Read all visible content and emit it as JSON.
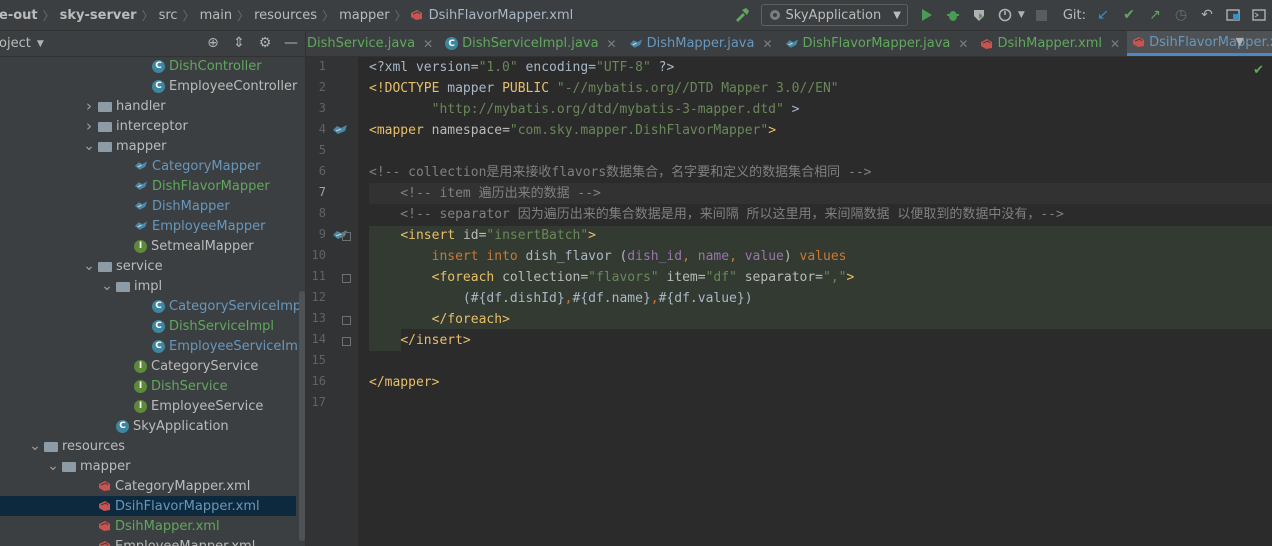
{
  "breadcrumb": {
    "items": [
      "e-out",
      "sky-server",
      "src",
      "main",
      "resources",
      "mapper"
    ],
    "file": "DsihFlavorMapper.xml"
  },
  "toolbar": {
    "run_config": "SkyApplication",
    "git_label": "Git:"
  },
  "project_pane": {
    "title": "roject",
    "tree": [
      {
        "indent": 152,
        "icon": "c",
        "label": "DishController",
        "color": "green"
      },
      {
        "indent": 152,
        "icon": "c",
        "label": "EmployeeController",
        "color": "default"
      },
      {
        "indent": 98,
        "arrow": "right",
        "icon": "folder",
        "label": "handler",
        "color": "default"
      },
      {
        "indent": 98,
        "arrow": "right",
        "icon": "folder",
        "label": "interceptor",
        "color": "default"
      },
      {
        "indent": 98,
        "arrow": "down",
        "icon": "folder",
        "label": "mapper",
        "color": "default"
      },
      {
        "indent": 134,
        "icon": "mapper",
        "label": "CategoryMapper",
        "color": "blue"
      },
      {
        "indent": 134,
        "icon": "mapper",
        "label": "DishFlavorMapper",
        "color": "green"
      },
      {
        "indent": 134,
        "icon": "mapper",
        "label": "DishMapper",
        "color": "blue"
      },
      {
        "indent": 134,
        "icon": "mapper",
        "label": "EmployeeMapper",
        "color": "blue"
      },
      {
        "indent": 134,
        "icon": "i",
        "label": "SetmealMapper",
        "color": "default"
      },
      {
        "indent": 98,
        "arrow": "down",
        "icon": "folder",
        "label": "service",
        "color": "default"
      },
      {
        "indent": 116,
        "arrow": "down",
        "icon": "folder",
        "label": "impl",
        "color": "default"
      },
      {
        "indent": 152,
        "icon": "c",
        "label": "CategoryServiceImpl",
        "color": "blue"
      },
      {
        "indent": 152,
        "icon": "c",
        "label": "DishServiceImpl",
        "color": "green"
      },
      {
        "indent": 152,
        "icon": "c",
        "label": "EmployeeServiceImp",
        "color": "blue"
      },
      {
        "indent": 134,
        "icon": "i",
        "label": "CategoryService",
        "color": "default"
      },
      {
        "indent": 134,
        "icon": "i",
        "label": "DishService",
        "color": "green"
      },
      {
        "indent": 134,
        "icon": "i",
        "label": "EmployeeService",
        "color": "default"
      },
      {
        "indent": 116,
        "icon": "c",
        "label": "SkyApplication",
        "color": "default"
      },
      {
        "indent": 44,
        "arrow": "down",
        "icon": "folder",
        "label": "resources",
        "color": "default"
      },
      {
        "indent": 62,
        "arrow": "down",
        "icon": "folder",
        "label": "mapper",
        "color": "default"
      },
      {
        "indent": 98,
        "icon": "xml",
        "label": "CategoryMapper.xml",
        "color": "default"
      },
      {
        "indent": 98,
        "icon": "xml",
        "label": "DsihFlavorMapper.xml",
        "color": "blue",
        "selected": true
      },
      {
        "indent": 98,
        "icon": "xml",
        "label": "DsihMapper.xml",
        "color": "green"
      },
      {
        "indent": 98,
        "icon": "xml",
        "label": "EmployeeMapper.xml",
        "color": "default"
      }
    ]
  },
  "tabs": [
    {
      "label": "DishService.java",
      "icon": "i",
      "color": "green"
    },
    {
      "label": "DishServiceImpl.java",
      "icon": "c",
      "color": "green"
    },
    {
      "label": "DishMapper.java",
      "icon": "mapper",
      "color": "blue"
    },
    {
      "label": "DishFlavorMapper.java",
      "icon": "mapper",
      "color": "green"
    },
    {
      "label": "DsihMapper.xml",
      "icon": "xml",
      "color": "green"
    },
    {
      "label": "DsihFlavorMapper.xml",
      "icon": "xml",
      "color": "blue",
      "active": true
    }
  ],
  "editor": {
    "line_numbers": [
      "1",
      "2",
      "3",
      "4",
      "5",
      "6",
      "7",
      "8",
      "9",
      "10",
      "11",
      "12",
      "13",
      "14",
      "15",
      "16",
      "17"
    ],
    "current_line": "7",
    "lines": [
      [
        [
          "t-plain",
          "<?xml version="
        ],
        [
          "t-val",
          "\"1.0\""
        ],
        [
          "t-plain",
          " encoding="
        ],
        [
          "t-val",
          "\"UTF-8\""
        ],
        [
          "t-plain",
          " ?>"
        ]
      ],
      [
        [
          "t-tag",
          "<!DOCTYPE "
        ],
        [
          "t-plain",
          "mapper "
        ],
        [
          "t-tag",
          "PUBLIC "
        ],
        [
          "t-val",
          "\"-//mybatis.org//DTD Mapper 3.0//EN\""
        ]
      ],
      [
        [
          "t-val",
          "        \"http://mybatis.org/dtd/mybatis-3-mapper.dtd\""
        ],
        [
          "t-plain",
          " >"
        ]
      ],
      [
        [
          "t-tag",
          "<mapper "
        ],
        [
          "t-attr",
          "namespace="
        ],
        [
          "t-val",
          "\"com.sky.mapper.DishFlavorMapper\""
        ],
        [
          "t-tag",
          ">"
        ]
      ],
      [],
      [
        [
          "t-cmt",
          "<!-- collection是用来接收flavors数据集合，名字要和定义的数据集合相同 -->"
        ]
      ],
      [
        [
          "t-cmt",
          "    <!-- item 遍历出来的数据 -->"
        ]
      ],
      [
        [
          "t-cmt",
          "    <!-- separator 因为遍历出来的集合数据是用，来间隔 所以这里用，来间隔数据 以便取到的数据中没有，-->"
        ]
      ],
      [
        [
          "t-plain",
          "    "
        ],
        [
          "t-tag",
          "<insert "
        ],
        [
          "t-attr",
          "id="
        ],
        [
          "t-val",
          "\"insertBatch\""
        ],
        [
          "t-tag",
          ">"
        ]
      ],
      [
        [
          "t-plain",
          "        "
        ],
        [
          "t-kw",
          "insert into "
        ],
        [
          "t-plain",
          "dish_flavor ("
        ],
        [
          "t-col",
          "dish_id"
        ],
        [
          "t-kw",
          ", "
        ],
        [
          "t-col",
          "name"
        ],
        [
          "t-kw",
          ", "
        ],
        [
          "t-col",
          "value"
        ],
        [
          "t-plain",
          ") "
        ],
        [
          "t-kw",
          "values"
        ]
      ],
      [
        [
          "t-plain",
          "        "
        ],
        [
          "t-tag",
          "<foreach "
        ],
        [
          "t-attr",
          "collection="
        ],
        [
          "t-val",
          "\"flavors\""
        ],
        [
          "t-attr",
          " item="
        ],
        [
          "t-val",
          "\"df\""
        ],
        [
          "t-attr",
          " separator="
        ],
        [
          "t-val",
          "\",\""
        ],
        [
          "t-tag",
          ">"
        ]
      ],
      [
        [
          "t-plain",
          "            (#{df.dishId}"
        ],
        [
          "t-kw",
          ","
        ],
        [
          "t-plain",
          "#{df.name}"
        ],
        [
          "t-kw",
          ","
        ],
        [
          "t-plain",
          "#{df.value})"
        ]
      ],
      [
        [
          "t-plain",
          "        "
        ],
        [
          "t-tag",
          "</foreach>"
        ]
      ],
      [
        [
          "t-plain",
          "    "
        ],
        [
          "t-tag",
          "</insert>"
        ]
      ],
      [],
      [
        [
          "t-tag",
          "</mapper>"
        ]
      ],
      []
    ]
  }
}
